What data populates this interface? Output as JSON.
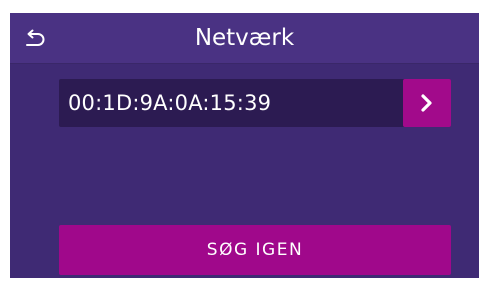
{
  "header": {
    "title": "Netværk",
    "back_icon": "back-arrow-icon"
  },
  "network_list": {
    "items": [
      {
        "name": "00:1D:9A:0A:15:39",
        "action_icon": "chevron-right-icon"
      }
    ]
  },
  "actions": {
    "search_again_label": "SØG IGEN"
  },
  "colors": {
    "background": "#3f2a74",
    "header_background": "#4a3283",
    "row_background": "#2c1b52",
    "accent": "#a20a8b",
    "text": "#ffffff"
  }
}
